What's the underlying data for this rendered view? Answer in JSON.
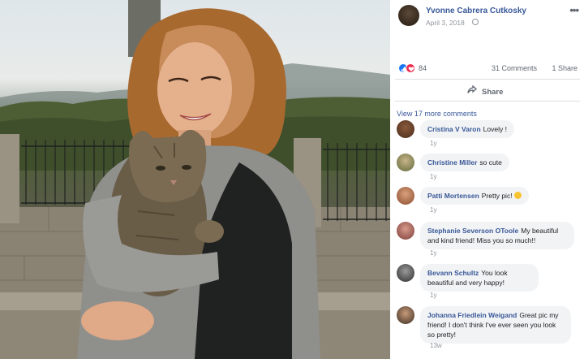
{
  "post": {
    "author": "Yvonne Cabrera Cutkosky",
    "date": "April 3, 2018",
    "privacy_icon": "globe-icon",
    "more_icon": "ellipsis-icon",
    "more_label": "•••"
  },
  "stats": {
    "reaction_icons": [
      "like-icon",
      "love-icon"
    ],
    "reaction_count": "84",
    "comments_count": "31 Comments",
    "shares_count": "1 Share"
  },
  "actions": {
    "share_label": "Share"
  },
  "view_more": "View 17 more comments",
  "comments": [
    {
      "author": "Cristina V Varon",
      "text": "Lovely !",
      "time": "1y"
    },
    {
      "author": "Christine Miller",
      "text": "so cute",
      "time": "1y"
    },
    {
      "author": "Patti Mortensen",
      "text": "Pretty pic!",
      "time": "1y"
    },
    {
      "author": "Stephanie Severson OToole",
      "text": "My beautiful and kind friend! Miss you so much!!",
      "time": "1y"
    },
    {
      "author": "Bevann Schultz",
      "text": "You look beautiful and very happy!",
      "time": "1y"
    },
    {
      "author": "Johanna Friedlein Weigand",
      "text": "Great pic my friend! I don't think I've ever seen you look so pretty!",
      "time": "13w"
    }
  ],
  "colors": {
    "link": "#385898",
    "bubble": "#f2f3f5",
    "meta": "#90949c",
    "like": "#1877f2",
    "love": "#f0284a"
  }
}
